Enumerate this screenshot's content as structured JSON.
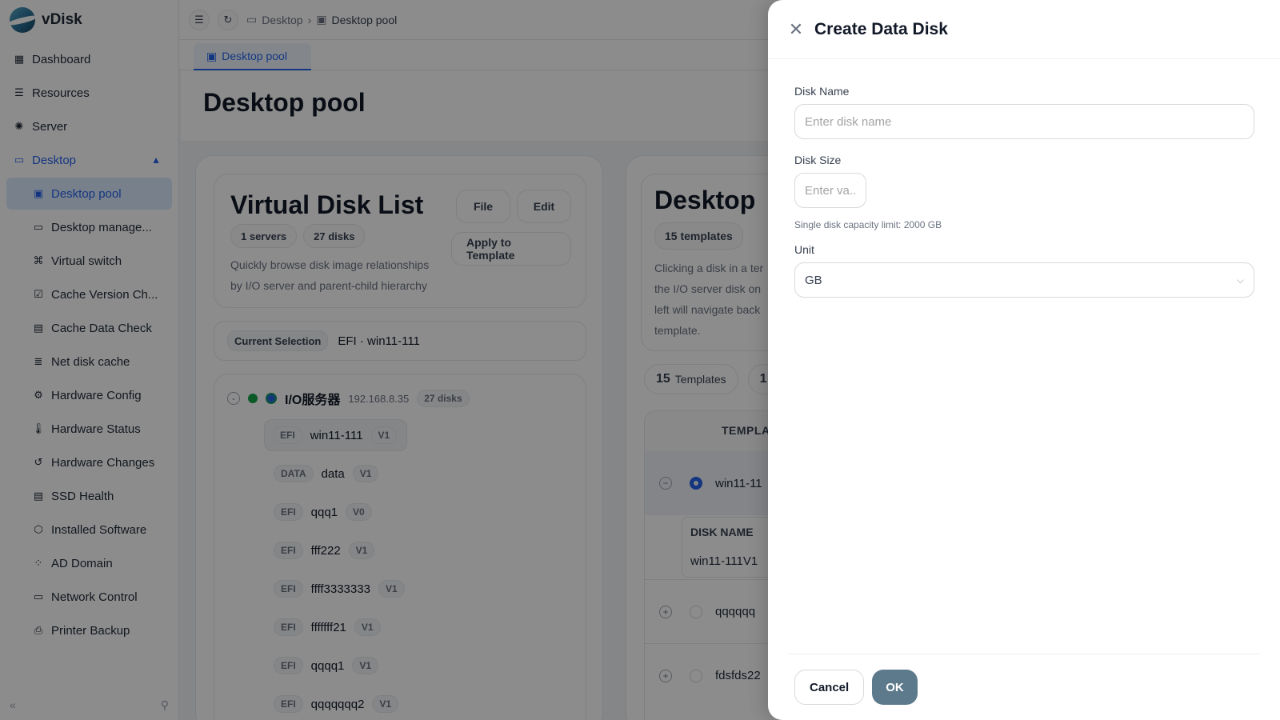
{
  "app": {
    "name": "vDisk"
  },
  "sidebar": {
    "items": [
      {
        "label": "Dashboard",
        "icon": "dashboard-icon"
      },
      {
        "label": "Resources",
        "icon": "resources-icon"
      },
      {
        "label": "Server",
        "icon": "server-icon"
      },
      {
        "label": "Desktop",
        "icon": "desktop-icon",
        "expanded": true
      },
      {
        "label": "Desktop pool",
        "icon": "image-icon",
        "active": true
      },
      {
        "label": "Desktop manage...",
        "icon": "monitor-icon"
      },
      {
        "label": "Virtual switch",
        "icon": "network-icon"
      },
      {
        "label": "Cache Version Ch...",
        "icon": "monitor-check-icon"
      },
      {
        "label": "Cache Data Check",
        "icon": "drive-icon"
      },
      {
        "label": "Net disk cache",
        "icon": "database-icon"
      },
      {
        "label": "Hardware Config",
        "icon": "chip-icon"
      },
      {
        "label": "Hardware Status",
        "icon": "thermometer-icon"
      },
      {
        "label": "Hardware Changes",
        "icon": "history-icon"
      },
      {
        "label": "SSD Health",
        "icon": "drive-icon"
      },
      {
        "label": "Installed Software",
        "icon": "package-icon"
      },
      {
        "label": "AD Domain",
        "icon": "domain-icon"
      },
      {
        "label": "Network Control",
        "icon": "monitor-icon"
      },
      {
        "label": "Printer Backup",
        "icon": "printer-icon"
      }
    ]
  },
  "breadcrumb": {
    "parent": "Desktop",
    "current": "Desktop pool"
  },
  "tabs": [
    {
      "label": "Desktop pool"
    }
  ],
  "page": {
    "title": "Desktop pool"
  },
  "disk_list": {
    "title": "Virtual Disk List",
    "servers_pill": "1 servers",
    "disks_pill": "27 disks",
    "file_button": "File",
    "edit_button": "Edit",
    "apply_button": "Apply to Template",
    "description_1": "Quickly browse disk image relationships",
    "description_2": "by I/O server and parent-child hierarchy",
    "current_selection_label": "Current Selection",
    "current_selection_value": "EFI · win11-111",
    "server": {
      "name": "I/O服务器",
      "ip": "192.168.8.35",
      "disks": "27 disks",
      "collapse": "-"
    },
    "disks": [
      {
        "type": "EFI",
        "name": "win11-111",
        "version": "V1"
      },
      {
        "type": "DATA",
        "name": "data",
        "version": "V1"
      },
      {
        "type": "EFI",
        "name": "qqq1",
        "version": "V0"
      },
      {
        "type": "EFI",
        "name": "fff222",
        "version": "V1"
      },
      {
        "type": "EFI",
        "name": "ffff3333333",
        "version": "V1"
      },
      {
        "type": "EFI",
        "name": "fffffff21",
        "version": "V1"
      },
      {
        "type": "EFI",
        "name": "qqqq1",
        "version": "V1"
      },
      {
        "type": "EFI",
        "name": "qqqqqqq2",
        "version": "V1"
      }
    ]
  },
  "templates_card": {
    "title": "Desktop",
    "pill": "15 templates",
    "description_1": "Clicking a disk in a ter",
    "description_2": "the I/O server disk on",
    "description_3": "left will navigate back",
    "description_4": "template.",
    "count_num": "15",
    "count_label": "Templates",
    "second_count": "1",
    "column_header": "TEMPLAT",
    "rows": [
      {
        "name": "win11-11"
      },
      {
        "name": "qqqqqq"
      },
      {
        "name": "fdsfds22"
      }
    ],
    "sub_header": "DISK NAME",
    "sub_value": "win11-111V1"
  },
  "dialog": {
    "title": "Create Data Disk",
    "disk_name_label": "Disk Name",
    "disk_name_placeholder": "Enter disk name",
    "disk_size_label": "Disk Size",
    "disk_size_placeholder": "Enter va...",
    "capacity_hint": "Single disk capacity limit: 2000 GB",
    "unit_label": "Unit",
    "unit_value": "GB",
    "cancel_label": "Cancel",
    "ok_label": "OK"
  },
  "colors": {
    "accent": "#2563eb",
    "ok_button": "#5d7a8c",
    "overlay": "rgba(0,0,0,0.45)"
  }
}
